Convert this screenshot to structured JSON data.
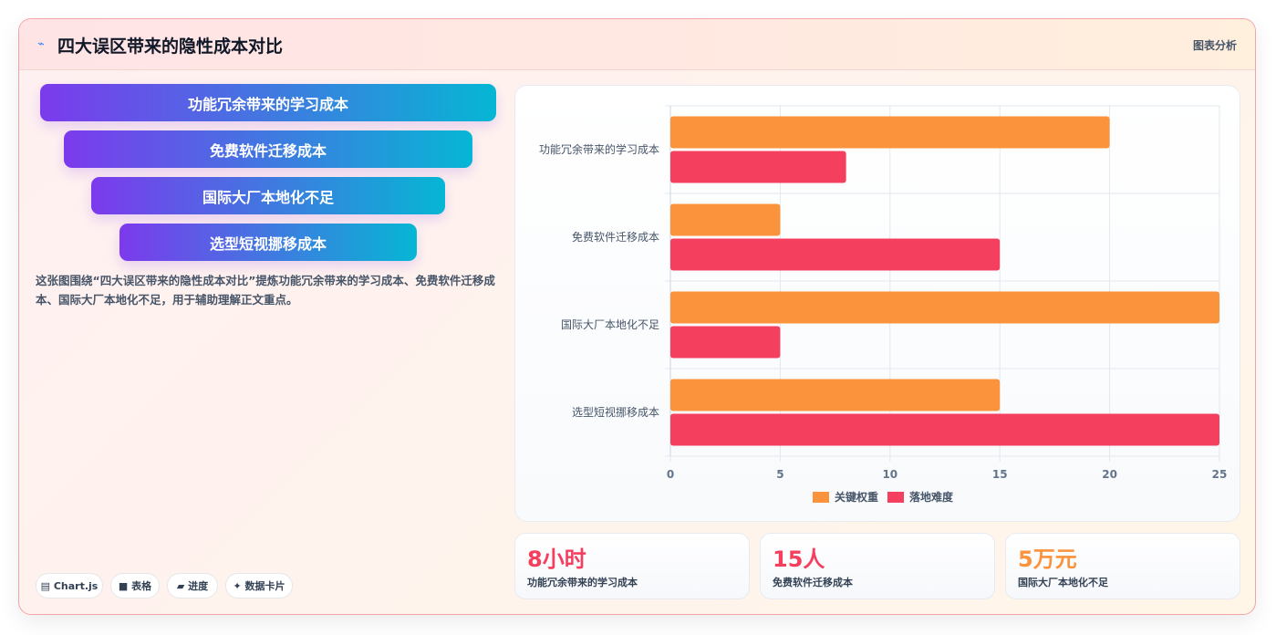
{
  "header": {
    "icon": "chart-icon",
    "title": "四大误区带来的隐性成本对比",
    "tag": "图表分析"
  },
  "funnel": {
    "items": [
      "功能冗余带来的学习成本",
      "免费软件迁移成本",
      "国际大厂本地化不足",
      "选型短视挪移成本"
    ]
  },
  "description": "这张图围绕“四大误区带来的隐性成本对比”提炼功能冗余带来的学习成本、免费软件迁移成本、国际大厂本地化不足，用于辅助理解正文重点。",
  "pills": [
    "▤ Chart.js",
    "■ 表格",
    "▰ 进度",
    "✦ 数据卡片"
  ],
  "colors": {
    "accent_start": "#7c3aed",
    "accent_end": "#06b6d4",
    "series_weight": "#fb923c",
    "series_difficulty": "#f43f5e"
  },
  "chart_data": {
    "type": "bar",
    "orientation": "horizontal",
    "categories": [
      "功能冗余带来的学习成本",
      "免费软件迁移成本",
      "国际大厂本地化不足",
      "选型短视挪移成本"
    ],
    "series": [
      {
        "name": "关键权重",
        "color": "#fb923c",
        "values": [
          20,
          5,
          25,
          15
        ]
      },
      {
        "name": "落地难度",
        "color": "#f43f5e",
        "values": [
          8,
          15,
          5,
          25
        ]
      }
    ],
    "xlim": [
      0,
      25
    ],
    "xticks": [
      0,
      5,
      10,
      15,
      20,
      25
    ],
    "grid": true,
    "legend": "bottom"
  },
  "stats": [
    {
      "value": "8小时",
      "label": "功能冗余带来的学习成本",
      "color": "#f43f5e"
    },
    {
      "value": "15人",
      "label": "免费软件迁移成本",
      "color": "#f43f5e"
    },
    {
      "value": "5万元",
      "label": "国际大厂本地化不足",
      "color": "#fb923c"
    }
  ]
}
